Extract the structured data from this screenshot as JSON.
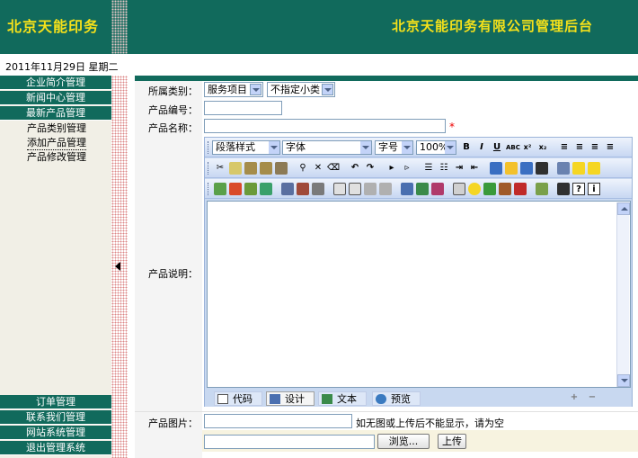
{
  "header": {
    "title": "北京天能印务",
    "subtitle": "北京天能印务有限公司管理后台"
  },
  "date": "2011年11月29日  星期二",
  "sidebar": {
    "items": [
      {
        "label": "企业简介管理"
      },
      {
        "label": "新闻中心管理"
      },
      {
        "label": "最新产品管理"
      }
    ],
    "subitems": [
      {
        "label": "产品类别管理"
      },
      {
        "label": "添加产品管理"
      },
      {
        "label": "产品修改管理"
      }
    ],
    "bottom_items": [
      {
        "label": "订单管理"
      },
      {
        "label": "联系我们管理"
      },
      {
        "label": "网站系统管理"
      },
      {
        "label": "退出管理系统"
      }
    ]
  },
  "form": {
    "category_label": "所属类别：",
    "category_value": "服务项目",
    "subcategory_value": "不指定小类",
    "code_label": "产品编号：",
    "name_label": "产品名称：",
    "required_mark": "*",
    "desc_label": "产品说明：",
    "image_label": "产品图片：",
    "image_note": "如无图或上传后不能显示，请为空",
    "browse_label": "浏览...",
    "upload_label": "上传"
  },
  "editor": {
    "paragraph_style": "段落样式",
    "font": "字体",
    "font_size": "字号",
    "zoom": "100%",
    "modes": [
      {
        "label": "代码"
      },
      {
        "label": "设计"
      },
      {
        "label": "文本"
      },
      {
        "label": "预览"
      }
    ],
    "active_mode": "设计"
  },
  "colors": {
    "header_bg": "#116a5c",
    "title_color": "#f5e11a",
    "sidebar_bg": "#f1efe6"
  }
}
